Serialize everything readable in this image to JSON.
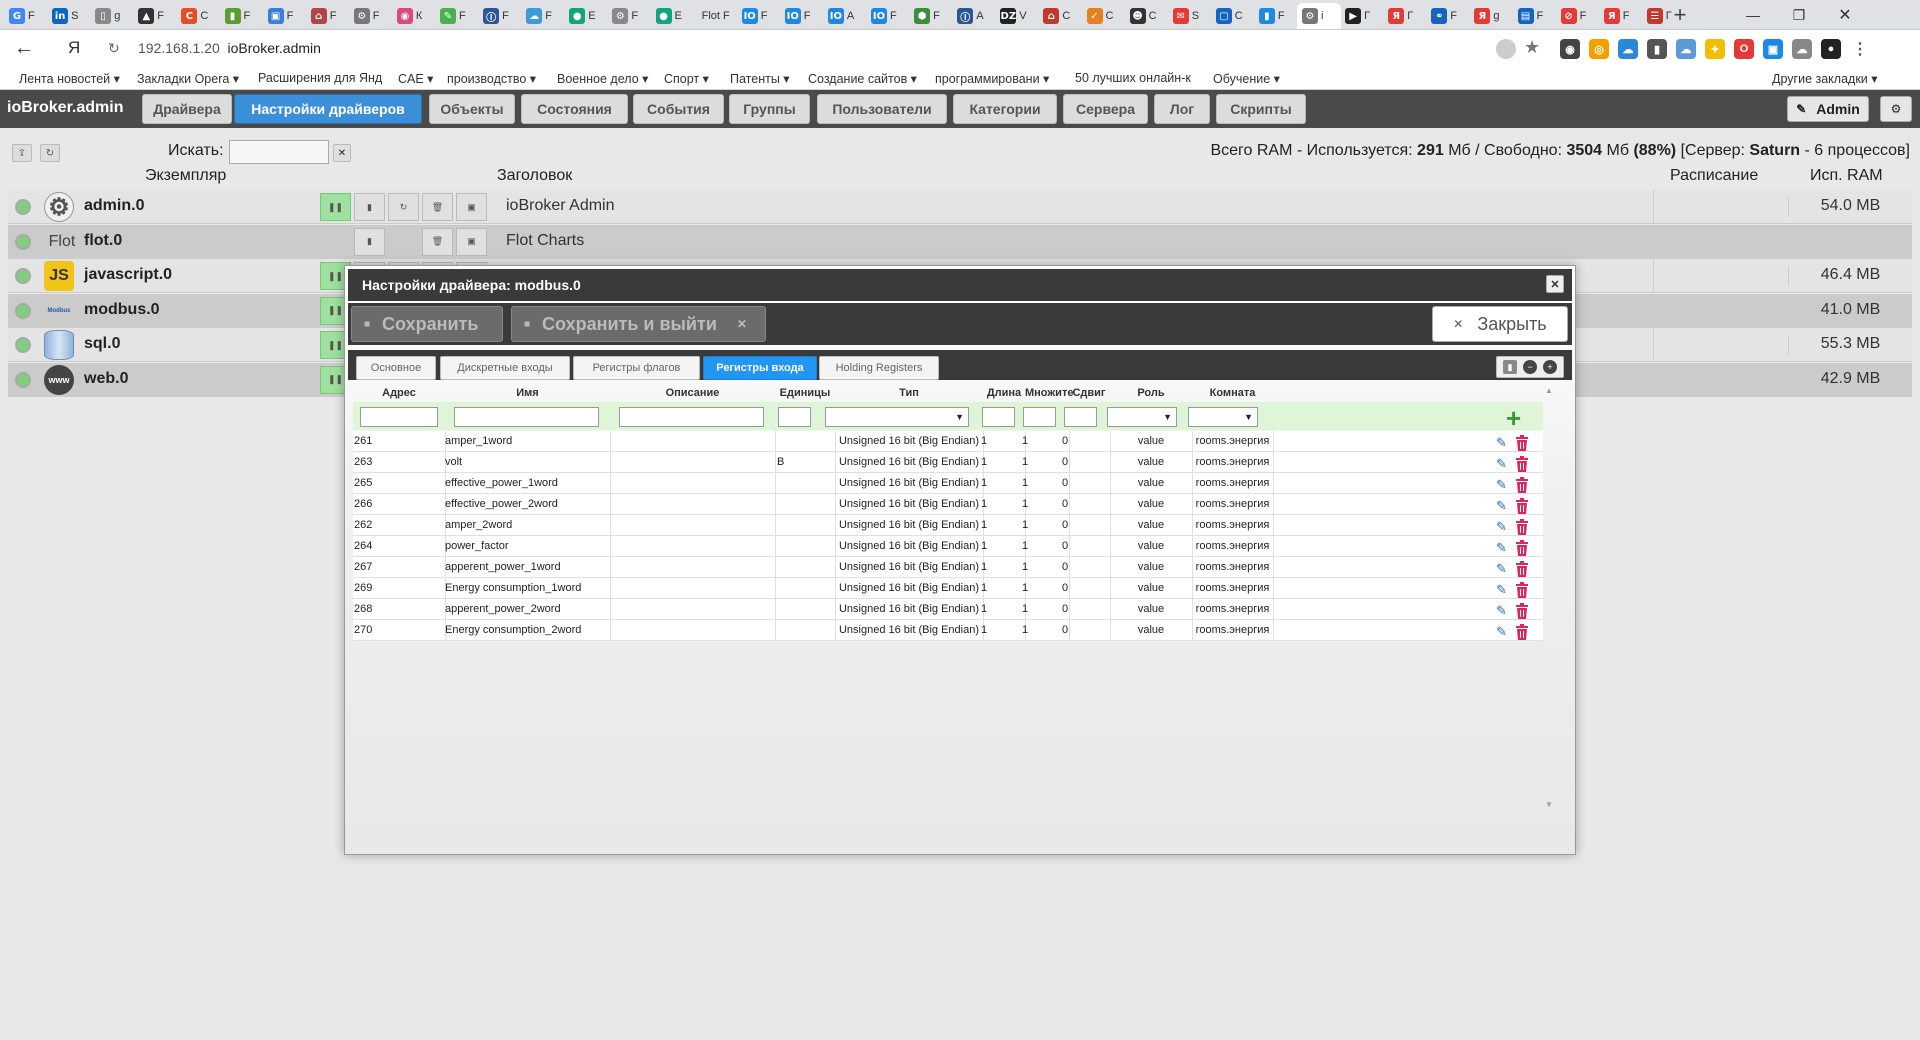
{
  "browser": {
    "tabs": [
      {
        "text": "F",
        "color": "#4285f4",
        "glyph": "G"
      },
      {
        "text": "S",
        "color": "#0a66c2",
        "glyph": "in"
      },
      {
        "text": "g",
        "color": "#888888",
        "glyph": "▯"
      },
      {
        "text": "F",
        "color": "#333333",
        "glyph": "▲"
      },
      {
        "text": "C",
        "color": "#e44d26",
        "glyph": "C"
      },
      {
        "text": "F",
        "color": "#5a9e2f",
        "glyph": "▮"
      },
      {
        "text": "F",
        "color": "#3b7dd8",
        "glyph": "▣"
      },
      {
        "text": "F",
        "color": "#b34545",
        "glyph": "⌂"
      },
      {
        "text": "F",
        "color": "#777777",
        "glyph": "⚙"
      },
      {
        "text": "К",
        "color": "#d94a7a",
        "glyph": "◉"
      },
      {
        "text": "F",
        "color": "#4caf50",
        "glyph": "✎"
      },
      {
        "text": "F",
        "color": "#2b5797",
        "glyph": "Ⓘ"
      },
      {
        "text": "F",
        "color": "#3c9bd6",
        "glyph": "☁"
      },
      {
        "text": "E",
        "color": "#12a37f",
        "glyph": "●"
      },
      {
        "text": "F",
        "color": "#888888",
        "glyph": "⚙"
      },
      {
        "text": "E",
        "color": "#12a37f",
        "glyph": "●"
      },
      {
        "text": "Flot F",
        "color": "#ffffff",
        "glyph": ""
      },
      {
        "text": "F",
        "color": "#1e88e5",
        "glyph": "IO"
      },
      {
        "text": "F",
        "color": "#1e88e5",
        "glyph": "IO"
      },
      {
        "text": "A",
        "color": "#1e88e5",
        "glyph": "IO"
      },
      {
        "text": "F",
        "color": "#1e88e5",
        "glyph": "IO"
      },
      {
        "text": "F",
        "color": "#3a8f3a",
        "glyph": "⬢"
      },
      {
        "text": "A",
        "color": "#2b5797",
        "glyph": "Ⓘ"
      },
      {
        "text": "V",
        "color": "#222222",
        "glyph": "DZ"
      },
      {
        "text": "C",
        "color": "#c0392b",
        "glyph": "⌂"
      },
      {
        "text": "C",
        "color": "#e67e22",
        "glyph": "✓"
      },
      {
        "text": "C",
        "color": "#333333",
        "glyph": "☻"
      },
      {
        "text": "S",
        "color": "#e53935",
        "glyph": "✉"
      },
      {
        "text": "C",
        "color": "#1565c0",
        "glyph": "▢"
      },
      {
        "text": "F",
        "color": "#1e88e5",
        "glyph": "▮"
      },
      {
        "text": "i",
        "color": "#777777",
        "glyph": "⚙"
      },
      {
        "text": "Г",
        "color": "#222222",
        "glyph": "▶"
      },
      {
        "text": "Г",
        "color": "#e53935",
        "glyph": "Я"
      },
      {
        "text": "F",
        "color": "#1565c0",
        "glyph": "⚭"
      },
      {
        "text": "g",
        "color": "#e53935",
        "glyph": "Я"
      },
      {
        "text": "F",
        "color": "#1565c0",
        "glyph": "▤"
      },
      {
        "text": "F",
        "color": "#e53935",
        "glyph": "⊘"
      },
      {
        "text": "F",
        "color": "#e53935",
        "glyph": "Я"
      },
      {
        "text": "Г",
        "color": "#c0392b",
        "glyph": "☰"
      }
    ],
    "address": {
      "ip": "192.168.1.20",
      "title": "ioBroker.admin",
      "ya": "Я"
    },
    "bookmarks": [
      "Лента новостей ▾",
      "Закладки Opera ▾",
      "Расширения для Янд",
      "CAE ▾",
      "производство ▾",
      "Военное дело ▾",
      "Спорт ▾",
      "Патенты ▾",
      "Создание сайтов ▾",
      "программировани ▾",
      "50 лучших онлайн-к",
      "Обучение ▾"
    ],
    "other_bookmarks": "Другие закладки ▾"
  },
  "app": {
    "brand": "ioBroker.admin",
    "tabs": [
      "Драйвера",
      "Настройки драйверов",
      "Объекты",
      "Состояния",
      "События",
      "Группы",
      "Пользователи",
      "Категории",
      "Сервера",
      "Лог",
      "Скрипты"
    ],
    "active_tab": "Настройки драйверов",
    "user": "Admin",
    "search_label": "Искать:",
    "ram": {
      "prefix": "Всего RAM - Используется: ",
      "used": "291",
      "mid": " Мб / Свободно: ",
      "free": "3504",
      "mid2": " Мб ",
      "pct": "(88%)",
      "mid3": " [Сервер: ",
      "server": "Saturn",
      "suffix": " - 6 процессов]"
    }
  },
  "instances": {
    "headers": {
      "instance": "Экземпляр",
      "title": "Заголовок",
      "schedule": "Расписание",
      "ram": "Исп. RAM"
    },
    "rows": [
      {
        "name": "admin.0",
        "title": "ioBroker Admin",
        "ram": "54.0 MB",
        "icon": "gear-icon",
        "icon_text": "⚙"
      },
      {
        "name": "flot.0",
        "title": "Flot Charts",
        "ram": "",
        "icon": "flot-icon",
        "icon_text": "Flot"
      },
      {
        "name": "javascript.0",
        "title": "",
        "ram": "46.4 MB",
        "icon": "js-icon",
        "icon_text": "JS"
      },
      {
        "name": "modbus.0",
        "title": "",
        "ram": "41.0 MB",
        "icon": "modbus-icon",
        "icon_text": "Modbus"
      },
      {
        "name": "sql.0",
        "title": "",
        "ram": "55.3 MB",
        "icon": "database-icon",
        "icon_text": ""
      },
      {
        "name": "web.0",
        "title": "",
        "ram": "42.9 MB",
        "icon": "www-icon",
        "icon_text": "www"
      }
    ]
  },
  "dialog": {
    "title": "Настройки драйвера: modbus.0",
    "save": "Сохранить",
    "save_exit": "Сохранить и выйти",
    "close": "Закрыть",
    "tabs": [
      "Основное",
      "Дискретные входы",
      "Регистры флагов",
      "Регистры входа",
      "Holding Registers"
    ],
    "active_tab": "Регистры входа",
    "columns": [
      "Адрес",
      "Имя",
      "Описание",
      "Единицы",
      "Тип",
      "Длина",
      "Множите",
      "Сдвиг",
      "Роль",
      "Комната"
    ],
    "rows": [
      {
        "addr": "261",
        "name": "amper_1word",
        "desc": "",
        "unit": "",
        "type": "Unsigned 16 bit (Big Endian)",
        "len": "1",
        "factor": "1",
        "offset": "0",
        "role": "value",
        "room": "rooms.энергия"
      },
      {
        "addr": "263",
        "name": "volt",
        "desc": "",
        "unit": "В",
        "type": "Unsigned 16 bit (Big Endian)",
        "len": "1",
        "factor": "1",
        "offset": "0",
        "role": "value",
        "room": "rooms.энергия"
      },
      {
        "addr": "265",
        "name": "effective_power_1word",
        "desc": "",
        "unit": "",
        "type": "Unsigned 16 bit (Big Endian)",
        "len": "1",
        "factor": "1",
        "offset": "0",
        "role": "value",
        "room": "rooms.энергия"
      },
      {
        "addr": "266",
        "name": "effective_power_2word",
        "desc": "",
        "unit": "",
        "type": "Unsigned 16 bit (Big Endian)",
        "len": "1",
        "factor": "1",
        "offset": "0",
        "role": "value",
        "room": "rooms.энергия"
      },
      {
        "addr": "262",
        "name": "amper_2word",
        "desc": "",
        "unit": "",
        "type": "Unsigned 16 bit (Big Endian)",
        "len": "1",
        "factor": "1",
        "offset": "0",
        "role": "value",
        "room": "rooms.энергия"
      },
      {
        "addr": "264",
        "name": "power_factor",
        "desc": "",
        "unit": "",
        "type": "Unsigned 16 bit (Big Endian)",
        "len": "1",
        "factor": "1",
        "offset": "0",
        "role": "value",
        "room": "rooms.энергия"
      },
      {
        "addr": "267",
        "name": "apperent_power_1word",
        "desc": "",
        "unit": "",
        "type": "Unsigned 16 bit (Big Endian)",
        "len": "1",
        "factor": "1",
        "offset": "0",
        "role": "value",
        "room": "rooms.энергия"
      },
      {
        "addr": "269",
        "name": "Energy consumption_1word",
        "desc": "",
        "unit": "",
        "type": "Unsigned 16 bit (Big Endian)",
        "len": "1",
        "factor": "1",
        "offset": "0",
        "role": "value",
        "room": "rooms.энергия"
      },
      {
        "addr": "268",
        "name": "apperent_power_2word",
        "desc": "",
        "unit": "",
        "type": "Unsigned 16 bit (Big Endian)",
        "len": "1",
        "factor": "1",
        "offset": "0",
        "role": "value",
        "room": "rooms.энергия"
      },
      {
        "addr": "270",
        "name": "Energy consumption_2word",
        "desc": "",
        "unit": "",
        "type": "Unsigned 16 bit (Big Endian)",
        "len": "1",
        "factor": "1",
        "offset": "0",
        "role": "value",
        "room": "rooms.энергия"
      }
    ]
  },
  "colors": {
    "accent": "#3b8fd9",
    "tab_active": "#2196f3",
    "header_bg": "#4a4a4a",
    "led_green": "#7ed07e",
    "add_green": "#3a9a3a",
    "delete_red": "#e0245e"
  }
}
